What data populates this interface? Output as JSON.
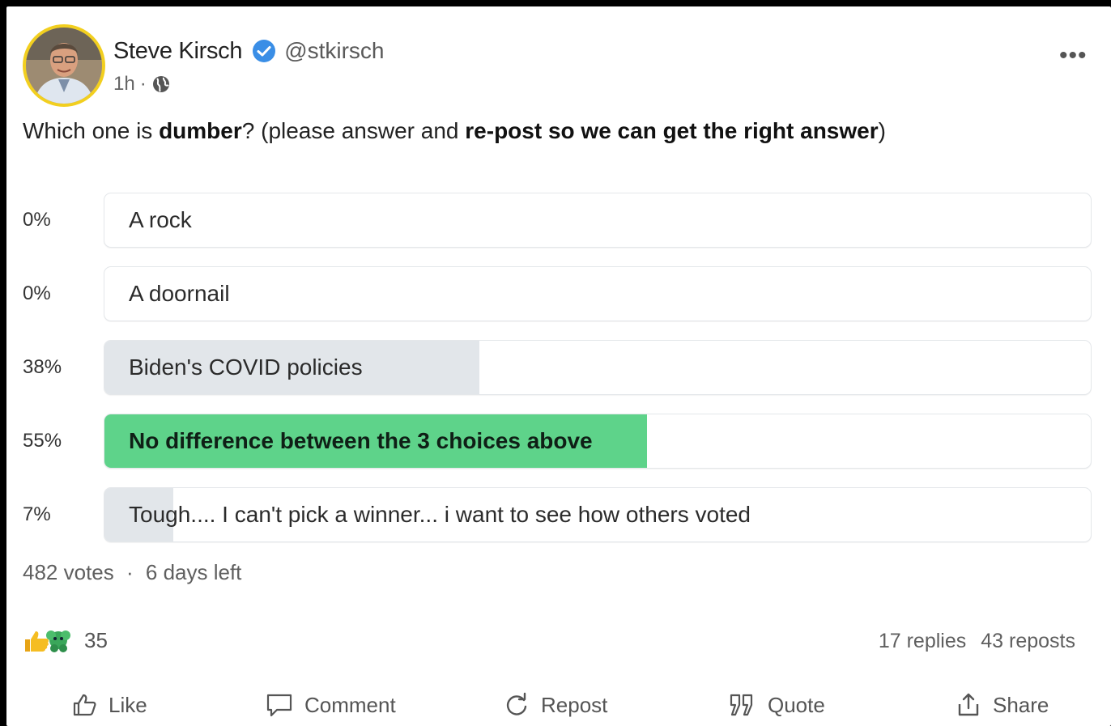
{
  "post": {
    "author": "Steve Kirsch",
    "handle": "@stkirsch",
    "time": "1h",
    "separator": "·",
    "more_label": "•••",
    "text_parts": [
      {
        "text": "Which one is ",
        "bold": false
      },
      {
        "text": "dumber",
        "bold": true
      },
      {
        "text": "? (please answer and ",
        "bold": false
      },
      {
        "text": "re-post so we can get the right answer",
        "bold": true
      },
      {
        "text": ")",
        "bold": false
      }
    ]
  },
  "poll": {
    "options": [
      {
        "pct_label": "0%",
        "percent": 0,
        "label": "A rock",
        "winner": false
      },
      {
        "pct_label": "0%",
        "percent": 0,
        "label": "A doornail",
        "winner": false
      },
      {
        "pct_label": "38%",
        "percent": 38,
        "label": "Biden's COVID policies",
        "winner": false
      },
      {
        "pct_label": "55%",
        "percent": 55,
        "label": "No difference between the 3 choices above",
        "winner": true
      },
      {
        "pct_label": "7%",
        "percent": 7,
        "label": "Tough.... I can't pick a winner... i want to see how others voted",
        "winner": false
      }
    ],
    "votes": "482 votes",
    "separator": "·",
    "time_left": "6 days left",
    "win_color": "#5ed38a",
    "bar_color": "#e2e6ea"
  },
  "engagement": {
    "reaction_icons": [
      "thumbs-up-icon",
      "care-icon"
    ],
    "reaction_count": "35",
    "replies": "17 replies",
    "reposts": "43 reposts"
  },
  "actions": {
    "like": "Like",
    "comment": "Comment",
    "repost": "Repost",
    "quote": "Quote",
    "share": "Share"
  },
  "colors": {
    "avatar_ring": "#f2cf1f",
    "verified": "#3a8ee6"
  }
}
